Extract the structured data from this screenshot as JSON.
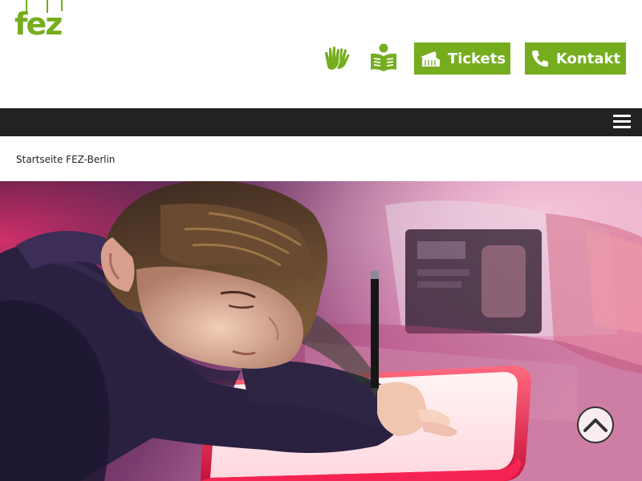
{
  "header": {
    "logo_text": "fez",
    "buttons": {
      "tickets_label": "Tickets",
      "contact_label": "Kontakt"
    },
    "icons": [
      "sign-language-icon",
      "easy-reading-icon",
      "ticket-icon",
      "phone-icon"
    ]
  },
  "nav": {
    "menu_icon": "hamburger-icon"
  },
  "breadcrumb": {
    "current": "Startseite FEZ-Berlin"
  },
  "hero": {
    "image": "child-drawing-on-lightbox-photo"
  },
  "colors": {
    "brand_green": "#75ad1f",
    "nav_dark": "#222222"
  }
}
